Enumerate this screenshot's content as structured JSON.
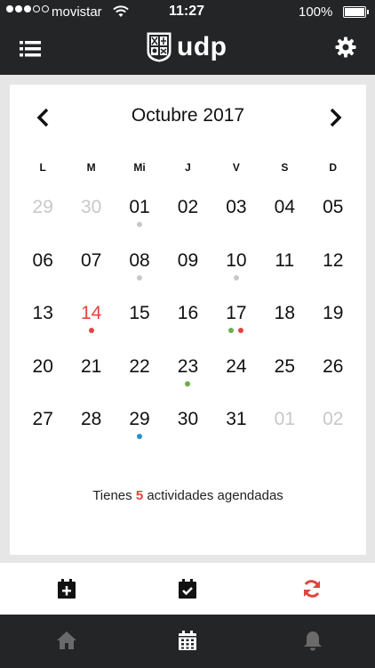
{
  "status_bar": {
    "carrier": "movistar",
    "time": "11:27",
    "battery": "100%"
  },
  "header": {
    "logo_text": "udp",
    "menu_icon": "hamburger-menu-icon",
    "settings_icon": "gear-icon"
  },
  "calendar": {
    "month_title": "Octubre 2017",
    "weekdays": [
      "L",
      "M",
      "Mi",
      "J",
      "V",
      "S",
      "D"
    ],
    "days": [
      {
        "label": "29",
        "muted": true,
        "dots": []
      },
      {
        "label": "30",
        "muted": true,
        "dots": []
      },
      {
        "label": "01",
        "muted": false,
        "dots": [
          "#c8c8c8"
        ]
      },
      {
        "label": "02",
        "muted": false,
        "dots": []
      },
      {
        "label": "03",
        "muted": false,
        "dots": []
      },
      {
        "label": "04",
        "muted": false,
        "dots": []
      },
      {
        "label": "05",
        "muted": false,
        "dots": []
      },
      {
        "label": "06",
        "muted": false,
        "dots": []
      },
      {
        "label": "07",
        "muted": false,
        "dots": []
      },
      {
        "label": "08",
        "muted": false,
        "dots": [
          "#c8c8c8"
        ]
      },
      {
        "label": "09",
        "muted": false,
        "dots": []
      },
      {
        "label": "10",
        "muted": false,
        "dots": [
          "#c8c8c8"
        ]
      },
      {
        "label": "11",
        "muted": false,
        "dots": []
      },
      {
        "label": "12",
        "muted": false,
        "dots": []
      },
      {
        "label": "13",
        "muted": false,
        "dots": []
      },
      {
        "label": "14",
        "muted": false,
        "today": true,
        "dots": [
          "#e0463f"
        ]
      },
      {
        "label": "15",
        "muted": false,
        "dots": []
      },
      {
        "label": "16",
        "muted": false,
        "dots": []
      },
      {
        "label": "17",
        "muted": false,
        "dots": [
          "#6ab04c",
          "#e0463f"
        ]
      },
      {
        "label": "18",
        "muted": false,
        "dots": []
      },
      {
        "label": "19",
        "muted": false,
        "dots": []
      },
      {
        "label": "20",
        "muted": false,
        "dots": []
      },
      {
        "label": "21",
        "muted": false,
        "dots": []
      },
      {
        "label": "22",
        "muted": false,
        "dots": []
      },
      {
        "label": "23",
        "muted": false,
        "dots": [
          "#6ab04c"
        ]
      },
      {
        "label": "24",
        "muted": false,
        "dots": []
      },
      {
        "label": "25",
        "muted": false,
        "dots": []
      },
      {
        "label": "26",
        "muted": false,
        "dots": []
      },
      {
        "label": "27",
        "muted": false,
        "dots": []
      },
      {
        "label": "28",
        "muted": false,
        "dots": []
      },
      {
        "label": "29",
        "muted": false,
        "dots": [
          "#2b8fc7"
        ]
      },
      {
        "label": "30",
        "muted": false,
        "dots": []
      },
      {
        "label": "31",
        "muted": false,
        "dots": []
      },
      {
        "label": "01",
        "muted": true,
        "dots": []
      },
      {
        "label": "02",
        "muted": true,
        "dots": []
      }
    ],
    "summary_prefix": "Tienes",
    "summary_count": "5",
    "summary_suffix": "actividades agendadas"
  },
  "actions": {
    "add_event_icon": "calendar-plus-icon",
    "check_icon": "calendar-check-icon",
    "sync_icon": "sync-icon"
  },
  "tabs": {
    "home_icon": "home-icon",
    "calendar_icon": "calendar-icon",
    "notifications_icon": "bell-icon"
  },
  "colors": {
    "bar_dark": "#232526",
    "accent_red": "#e0463f",
    "event_grey": "#c8c8c8",
    "event_green": "#6ab04c",
    "event_blue": "#2b8fc7",
    "tab_active": "#ffffff",
    "tab_inactive": "#6a6a6a"
  }
}
